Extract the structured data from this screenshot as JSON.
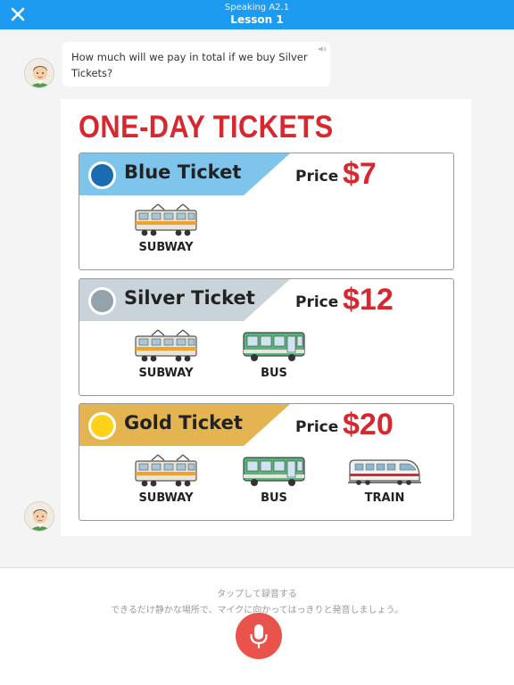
{
  "header": {
    "subtitle": "Speaking A2.1",
    "title": "Lesson 1",
    "bg_color": "#1c9bf0"
  },
  "question": {
    "text": "How much will we pay in total if we buy Silver Tickets?",
    "icon": "speaker-icon"
  },
  "card": {
    "title": "ONE-DAY TICKETS",
    "tickets": [
      {
        "name": "Blue Ticket",
        "price_label": "Price",
        "price": "$7",
        "band_color": "#7fc4ea",
        "dot_color": "#1b6bb3",
        "vehicles": [
          "SUBWAY"
        ]
      },
      {
        "name": "Silver Ticket",
        "price_label": "Price",
        "price": "$12",
        "band_color": "#c9d4da",
        "dot_color": "#94a2ab",
        "vehicles": [
          "SUBWAY",
          "BUS"
        ]
      },
      {
        "name": "Gold Ticket",
        "price_label": "Price",
        "price": "$20",
        "band_color": "#e3b44f",
        "dot_color": "#ffd21a",
        "vehicles": [
          "SUBWAY",
          "BUS",
          "TRAIN"
        ]
      }
    ]
  },
  "footer": {
    "hint_title": "タップして録音する",
    "hint_body": "できるだけ静かな場所で、マイクに向かってはっきりと発音しましょう。",
    "mic_icon": "microphone-icon",
    "mic_color": "#e9534c"
  }
}
